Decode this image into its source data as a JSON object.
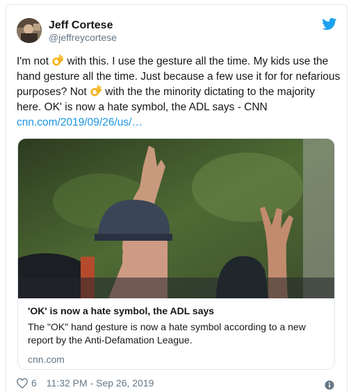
{
  "author": {
    "name": "Jeff Cortese",
    "handle": "@jeffreycortese"
  },
  "tweet": {
    "part1": "I'm not ",
    "part2": " with this. I use the gesture all the time. My kids use the hand gesture all the time. Just because a few use it for for nefarious purposes? Not ",
    "part3": " with the the minority dictating to the majority here. OK' is now a hate symbol, the ADL says - CNN",
    "link": "cnn.com/2019/09/26/us/…",
    "emoji": "ok-hand-icon"
  },
  "link_card": {
    "title": "'OK' is now a hate symbol, the ADL says",
    "description": "The \"OK\" hand gesture is now a hate symbol according to a new report by the Anti-Defamation League.",
    "domain": "cnn.com"
  },
  "footer": {
    "likes": "6",
    "timestamp": "11:32 PM - Sep 26, 2019"
  },
  "colors": {
    "link": "#1b95e0",
    "twitter_blue": "#1da1f2",
    "muted": "#657786",
    "border": "#e1e8ed"
  }
}
